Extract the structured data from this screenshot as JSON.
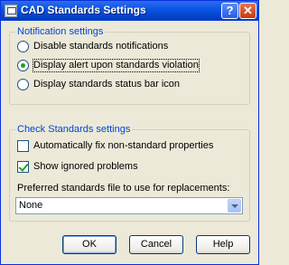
{
  "window": {
    "title": "CAD Standards Settings",
    "help_glyph": "?",
    "close_glyph": "✕"
  },
  "notification": {
    "legend": "Notification settings",
    "options": [
      {
        "label": "Disable standards notifications",
        "selected": false
      },
      {
        "label": "Display alert upon standards violation",
        "selected": true
      },
      {
        "label": "Display standards status bar icon",
        "selected": false
      }
    ]
  },
  "check": {
    "legend": "Check Standards settings",
    "auto_fix": {
      "label": "Automatically fix non-standard properties",
      "checked": false
    },
    "show_ignored": {
      "label": "Show ignored problems",
      "checked": true
    },
    "preferred_label": "Preferred standards file to use for replacements:",
    "preferred_value": "None"
  },
  "buttons": {
    "ok": "OK",
    "cancel": "Cancel",
    "help": "Help"
  },
  "colors": {
    "title_bar": "#0b55e4",
    "group_label": "#0046d5",
    "dialog_bg": "#ece9d8"
  }
}
